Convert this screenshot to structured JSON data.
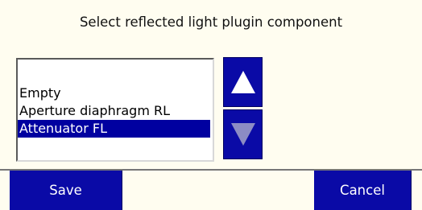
{
  "dialog": {
    "title": "Select reflected light plugin component"
  },
  "list": {
    "items": [
      {
        "label": "Empty",
        "selected": false
      },
      {
        "label": "Aperture diaphragm RL",
        "selected": false
      },
      {
        "label": "Attenuator FL",
        "selected": true
      }
    ]
  },
  "scroll": {
    "up_icon": "triangle-up-icon",
    "down_icon": "triangle-down-icon",
    "down_disabled": true
  },
  "buttons": {
    "save_label": "Save",
    "cancel_label": "Cancel"
  },
  "colors": {
    "background": "#fffdf0",
    "accent": "#0a0aa6",
    "selection": "#0000a0",
    "arrow_enabled": "#ffffff",
    "arrow_disabled": "#8c8cc4"
  }
}
